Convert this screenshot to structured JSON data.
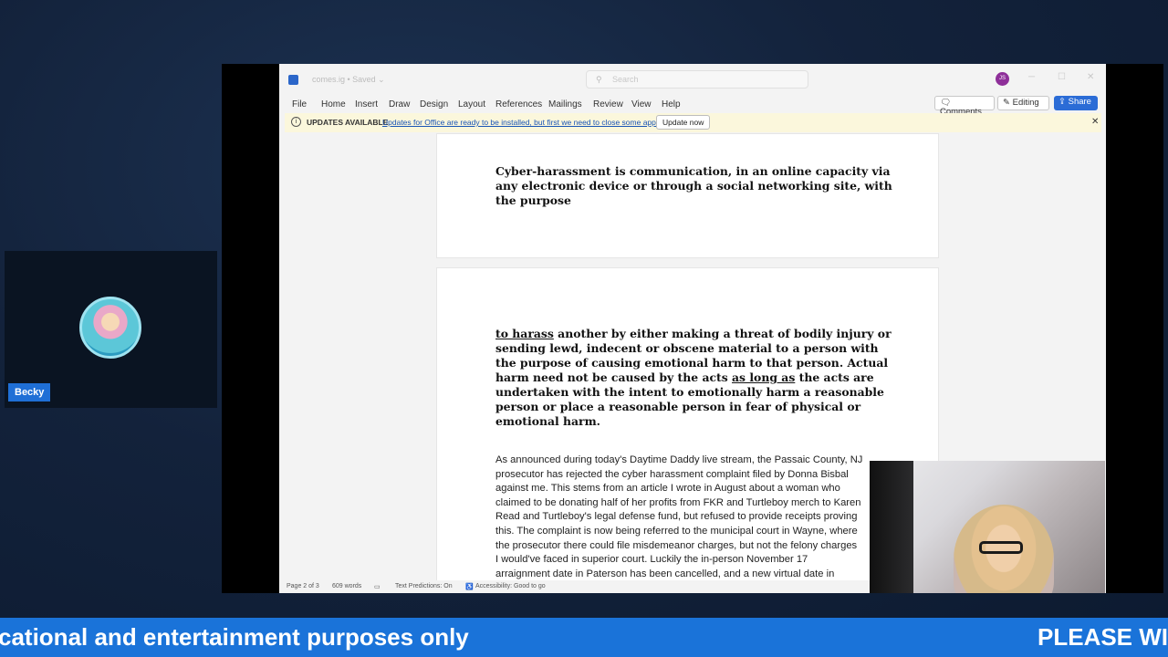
{
  "participant": {
    "name": "Becky"
  },
  "word": {
    "doc_name": "comes.ig • Saved ⌄",
    "search_placeholder": "Search",
    "user_initials": "JS",
    "menu": [
      "File",
      "Home",
      "Insert",
      "Draw",
      "Design",
      "Layout",
      "References",
      "Mailings",
      "Review",
      "View",
      "Help"
    ],
    "comments_label": "Comments",
    "editing_label": "Editing",
    "share_label": "Share",
    "update_bar": {
      "title": "UPDATES AVAILABLE",
      "message": "Updates for Office are ready to be installed, but first we need to close some apps.",
      "button": "Update now"
    },
    "page1_text": "Cyber-harassment is communication, in an online capacity via any electronic device or through a social networking site, with the purpose",
    "page2_heading_parts": [
      "to harass",
      " another by either making a threat of bodily injury or sending lewd, indecent or obscene material to a person with the purpose of causing emotional harm to that person. Actual harm need not be caused by the acts ",
      "as long as",
      " the acts are undertaken with the intent to emotionally harm a reasonable person or place a reasonable person in fear of physical or emotional harm."
    ],
    "page2_body_lines": [
      "As announced during today's Daytime Daddy live stream, the Passaic County, NJ",
      "prosecutor has rejected the cyber harassment complaint filed by Donna Bisbal",
      "against me. This stems from an article I wrote in August about a woman who",
      "claimed to be donating half of her profits from FKR and Turtleboy merch to Karen",
      "Read and Turtleboy's legal defense fund, but refused to provide receipts proving",
      "this. The complaint is now being referred to the municipal court in Wayne, where",
      "the prosecutor there could file misdemeanor charges, but not the felony charges",
      "I would've faced in superior court. Luckily the in-person November 17",
      "arraignment date in Paterson has been cancelled, and a new virtual date in"
    ],
    "status": {
      "page": "Page 2 of 3",
      "words": "609 words",
      "predictions": "Text Predictions: On",
      "accessibility": "Accessibility: Good to go"
    }
  },
  "ticker": {
    "left_text": "cational and entertainment purposes only",
    "right_text": "PLEASE WIF"
  }
}
